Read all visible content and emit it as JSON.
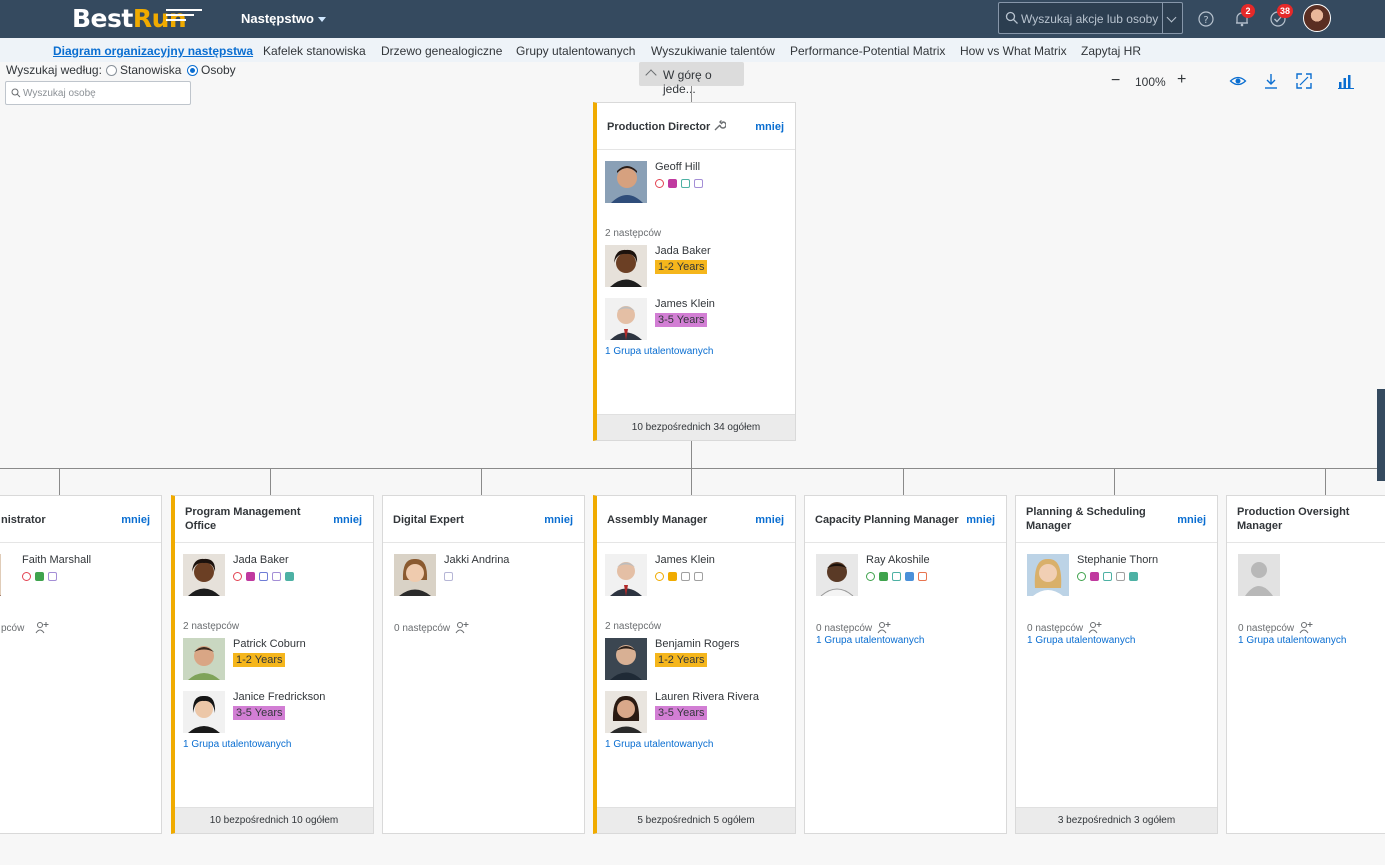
{
  "shell": {
    "logo_a": "Best",
    "logo_b": "Run",
    "app_menu": "Następstwo",
    "search_placeholder": "Wyszukaj akcje lub osoby",
    "notifications_count": "2",
    "tasks_count": "38"
  },
  "tabs": [
    "Diagram organizacyjny następstwa",
    "Kafelek stanowiska",
    "Drzewo genealogiczne",
    "Grupy utalentowanych",
    "Wyszukiwanie talentów",
    "Performance-Potential Matrix",
    "How vs What Matrix",
    "Zapytaj HR"
  ],
  "search": {
    "label": "Wyszukaj według:",
    "opt_positions": "Stanowiska",
    "opt_people": "Osoby",
    "placeholder": "Wyszukaj osobę"
  },
  "nav": {
    "up_button": "W górę o jede..."
  },
  "zoom": {
    "minus": "−",
    "value": "100%",
    "plus": "+"
  },
  "more_label": "mniej",
  "top": {
    "title": "Production Director",
    "incumbent": "Geoff Hill",
    "successors_label": "2 następców",
    "successors": [
      {
        "name": "Jada Baker",
        "readiness": "1-2 Years"
      },
      {
        "name": "James Klein",
        "readiness": "3-5 Years"
      }
    ],
    "pool_link": "1 Grupa utalentowanych",
    "footer": "10 bezpośrednich 34 ogółem"
  },
  "cards": [
    {
      "title": "nistrator",
      "incumbent": "Faith Marshall",
      "successors_label": "pców",
      "successors": [],
      "pool_link": "",
      "footer": ""
    },
    {
      "title": "Program Management Office",
      "incumbent": "Jada Baker",
      "successors_label": "2 następców",
      "successors": [
        {
          "name": "Patrick Coburn",
          "readiness": "1-2 Years"
        },
        {
          "name": "Janice Fredrickson",
          "readiness": "3-5 Years"
        }
      ],
      "pool_link": "1 Grupa utalentowanych",
      "footer": "10 bezpośrednich 10 ogółem"
    },
    {
      "title": "Digital Expert",
      "incumbent": "Jakki Andrina",
      "successors_label": "0 następców",
      "successors": [],
      "pool_link": "",
      "footer": ""
    },
    {
      "title": "Assembly Manager",
      "incumbent": "James Klein",
      "successors_label": "2 następców",
      "successors": [
        {
          "name": "Benjamin Rogers",
          "readiness": "1-2 Years"
        },
        {
          "name": "Lauren Rivera Rivera",
          "readiness": "3-5 Years"
        }
      ],
      "pool_link": "1 Grupa utalentowanych",
      "footer": "5 bezpośrednich 5 ogółem"
    },
    {
      "title": "Capacity Planning Manager",
      "incumbent": "Ray Akoshile",
      "successors_label": "0 następców",
      "successors": [],
      "pool_link": "1 Grupa utalentowanych",
      "footer": ""
    },
    {
      "title": "Planning & Scheduling Manager",
      "incumbent": "Stephanie Thorn",
      "successors_label": "0 następców",
      "successors": [],
      "pool_link": "1 Grupa utalentowanych",
      "footer": "3 bezpośrednich 3 ogółem"
    },
    {
      "title": "Production Oversight Manager",
      "incumbent": "",
      "successors_label": "0 następców",
      "successors": [],
      "pool_link": "1 Grupa utalentowanych",
      "footer": ""
    }
  ],
  "colors": {
    "shell": "#354a5f",
    "link": "#0a6ed1",
    "accent": "#f0ab00",
    "ready_1_2": "#f5b61c",
    "ready_3_5": "#d27ed4"
  }
}
